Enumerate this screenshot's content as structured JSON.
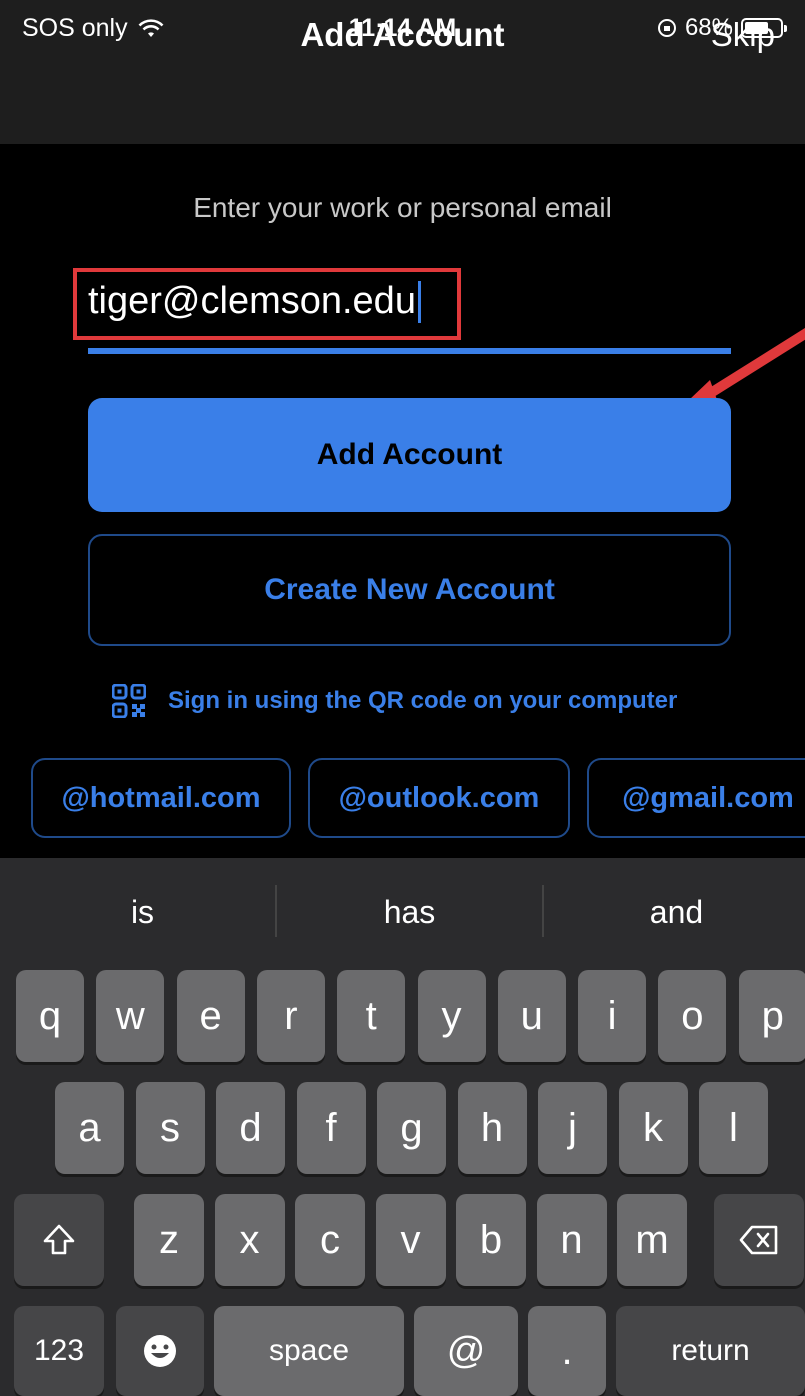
{
  "status_bar": {
    "carrier": "SOS only",
    "time": "11:14 AM",
    "battery": "68%",
    "battery_level": 0.68
  },
  "nav": {
    "title": "Add Account",
    "skip_label": "Skip"
  },
  "form": {
    "prompt": "Enter your work or personal email",
    "email_value": "tiger@clemson.edu",
    "add_button": "Add Account",
    "create_button": "Create New Account",
    "qr_label": "Sign in using the QR code on your computer"
  },
  "domain_chips": [
    "@hotmail.com",
    "@outlook.com",
    "@gmail.com"
  ],
  "annotation": {
    "highlight_color": "#e0393b",
    "arrow_color": "#e0393b"
  },
  "colors": {
    "accent": "#3a7fe8"
  },
  "keyboard": {
    "suggestions": [
      "is",
      "has",
      "and"
    ],
    "row1": [
      "q",
      "w",
      "e",
      "r",
      "t",
      "y",
      "u",
      "i",
      "o",
      "p"
    ],
    "row2": [
      "a",
      "s",
      "d",
      "f",
      "g",
      "h",
      "j",
      "k",
      "l"
    ],
    "row3": [
      "z",
      "x",
      "c",
      "v",
      "b",
      "n",
      "m"
    ],
    "numbers_key": "123",
    "space_key": "space",
    "at_key": "@",
    "dot_key": ".",
    "return_key": "return",
    "shift_icon": "shift-icon",
    "delete_icon": "delete-icon",
    "emoji_icon": "emoji-icon"
  }
}
